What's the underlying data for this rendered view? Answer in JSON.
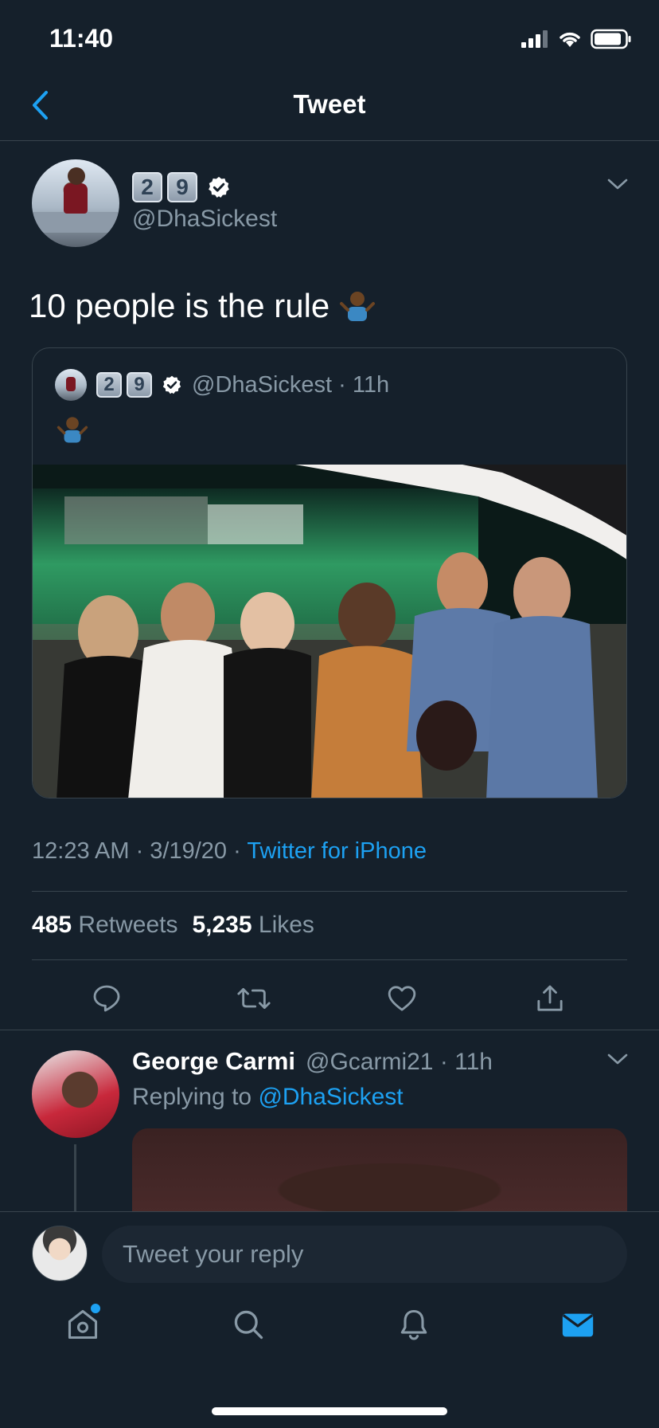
{
  "status_bar": {
    "time": "11:40"
  },
  "nav": {
    "title": "Tweet"
  },
  "tweet": {
    "name_digits": [
      "2",
      "9"
    ],
    "handle": "@DhaSickest",
    "text": "10 people is the rule",
    "timestamp": "12:23 AM · 3/19/20 · ",
    "source": "Twitter for iPhone",
    "retweets_count": "485",
    "retweets_label": "Retweets",
    "likes_count": "5,235",
    "likes_label": "Likes"
  },
  "quote": {
    "name_digits": [
      "2",
      "9"
    ],
    "handle_time": "@DhaSickest · 11h"
  },
  "reply": {
    "name": "George Carmi",
    "handle_time": "@Gcarmi21 · 11h",
    "replying_prefix": "Replying to ",
    "replying_handle": "@DhaSickest"
  },
  "composer": {
    "placeholder": "Tweet your reply"
  },
  "icons": {
    "back": "chevron-left-icon",
    "verified": "verified-badge-icon",
    "more": "chevron-down-icon",
    "actions": [
      "reply-icon",
      "retweet-icon",
      "like-icon",
      "share-icon"
    ],
    "tabs": [
      "home-icon",
      "search-icon",
      "notifications-icon",
      "messages-icon"
    ]
  },
  "colors": {
    "background": "#15202b",
    "accent": "#1da1f2",
    "secondary_text": "#8899a6",
    "divider": "#38444d"
  }
}
